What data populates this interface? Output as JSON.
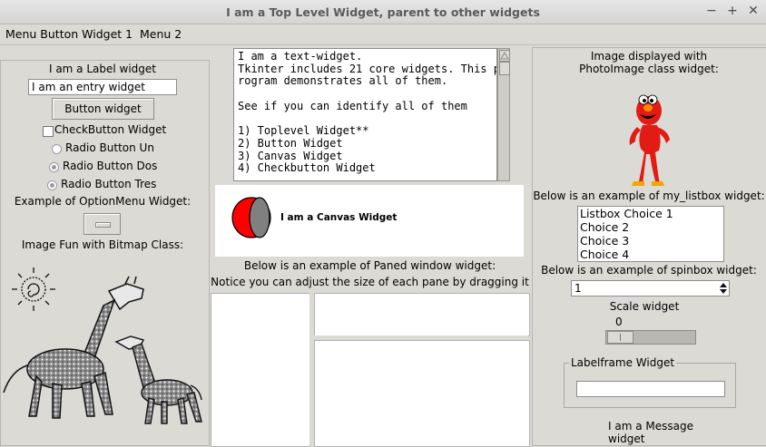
{
  "window": {
    "title": "I am a Top Level Widget, parent to other widgets",
    "controls": [
      "−",
      "+",
      "✕"
    ]
  },
  "menubar": {
    "items": [
      "Menu Button Widget 1",
      "Menu 2"
    ]
  },
  "left": {
    "label": "I am a Label widget",
    "entry_value": "I am an entry widget",
    "button_label": "Button widget",
    "checkbutton_label": "CheckButton Widget",
    "checkbutton_checked": false,
    "radios": [
      {
        "label": "Radio Button  Un",
        "selected": false
      },
      {
        "label": "Radio Button  Dos",
        "selected": true
      },
      {
        "label": "Radio Button  Tres",
        "selected": true
      }
    ],
    "optionmenu_heading": "Example of OptionMenu Widget:",
    "bitmap_heading": "Image Fun with Bitmap Class:"
  },
  "middle": {
    "text_lines": [
      "I am a text-widget.",
      "Tkinter includes 21 core widgets. This p",
      "rogram demonstrates all of them.",
      "",
      "See if you can identify all of them",
      "",
      "1) Toplevel Widget**",
      "2) Button Widget",
      "3) Canvas Widget",
      "4) Checkbutton Widget"
    ],
    "canvas_label": "I am a Canvas Widget",
    "paned_heading_1": "Below is an example of Paned window widget:",
    "paned_heading_2": "Notice you can adjust the size of each pane by dragging it"
  },
  "right": {
    "image_heading_1": "Image displayed with",
    "image_heading_2": "PhotoImage class widget:",
    "listbox_heading": "Below is an example of my_listbox widget:",
    "listbox_items": [
      "Listbox Choice 1",
      "Choice 2",
      "Choice 3",
      "Choice 4"
    ],
    "spinbox_heading": "Below is an example of spinbox widget:",
    "spinbox_value": "1",
    "scale_heading": "Scale widget",
    "scale_value": "0",
    "labelframe_title": "Labelframe Widget",
    "message_line_1": "I am a Message",
    "message_line_2": "widget"
  }
}
